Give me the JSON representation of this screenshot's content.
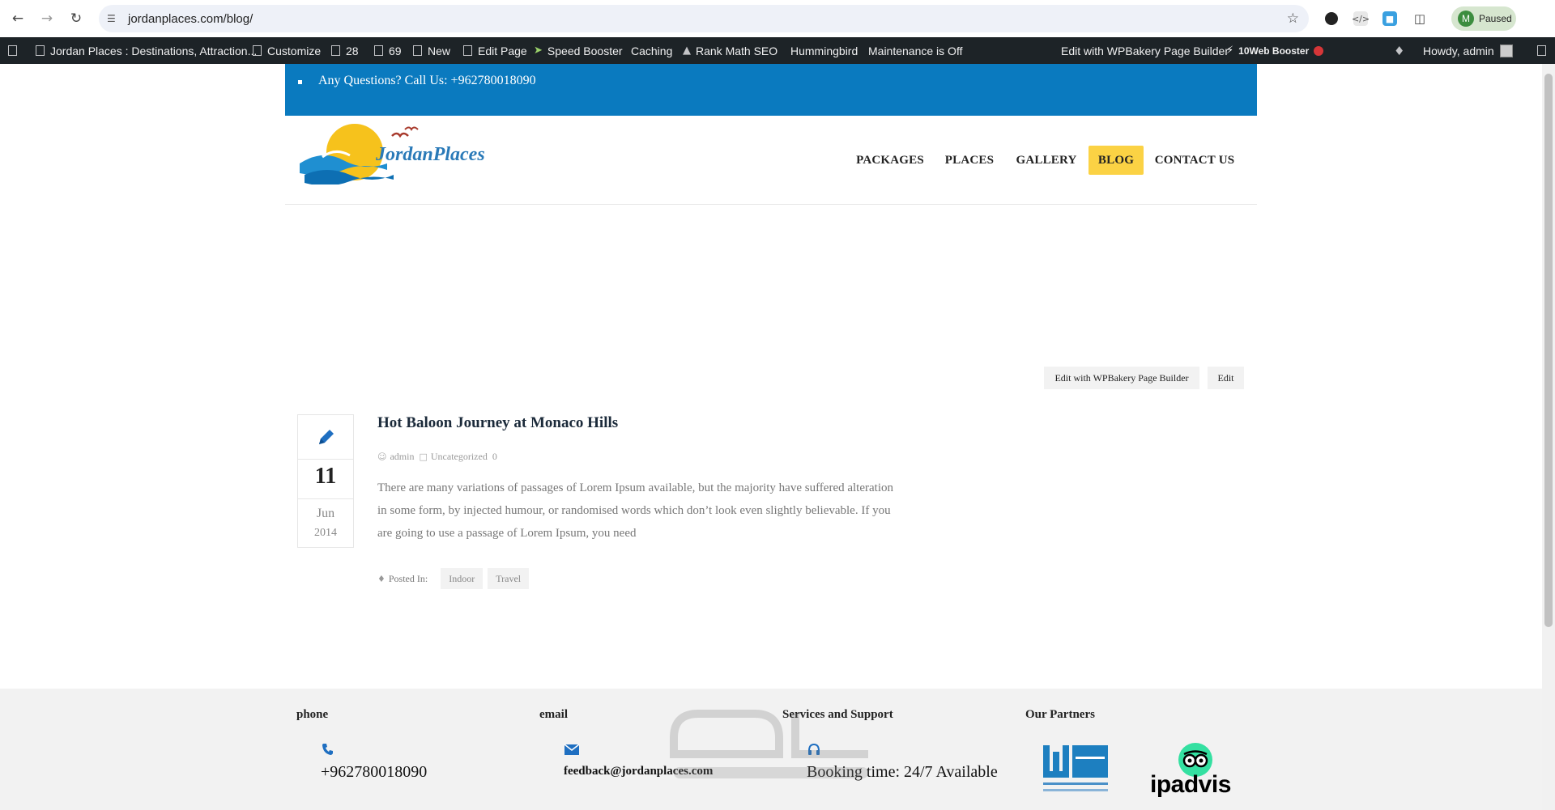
{
  "browser": {
    "url": "jordanplaces.com/blog/",
    "profile_initial": "M",
    "profile_label": "Paused"
  },
  "adminbar": {
    "site_name": "Jordan Places : Destinations, Attraction...",
    "customize": "Customize",
    "updates_count": "28",
    "comments_count": "69",
    "new": "New",
    "edit_page": "Edit Page",
    "speed_booster": "Speed Booster",
    "caching": "Caching",
    "rank_math": "Rank Math SEO",
    "hummingbird": "Hummingbird",
    "maintenance": "Maintenance is Off",
    "wpbakery": "Edit with WPBakery Page Builder",
    "booster": "10Web Booster",
    "howdy": "Howdy, admin"
  },
  "topbar": {
    "text": "Any Questions? Call Us: +962780018090"
  },
  "logo": {
    "text": "JordanPlaces"
  },
  "nav": {
    "items": [
      "PACKAGES",
      "PLACES",
      "GALLERY",
      "BLOG",
      "CONTACT US"
    ],
    "active": "BLOG"
  },
  "edit_buttons": {
    "wpbakery": "Edit with WPBakery Page Builder",
    "edit": "Edit"
  },
  "post": {
    "day": "11",
    "month": "Jun",
    "year": "2014",
    "title": "Hot Baloon Journey at Monaco Hills",
    "author": "admin",
    "category": "Uncategorized",
    "comments": "0",
    "excerpt_lines": [
      "There are many variations of passages of Lorem Ipsum available, but the majority have suffered alteration",
      "in some form, by injected humour, or randomised words which don’t look even slightly believable. If you",
      "are going to use a passage of Lorem Ipsum, you need"
    ],
    "posted_in_label": "Posted In:",
    "tags": [
      "Indoor",
      "Travel"
    ]
  },
  "footer": {
    "phone_heading": "phone",
    "phone_value": "+962780018090",
    "email_heading": "email",
    "email_value": "feedback@jordanplaces.com",
    "services_heading": "Services and Support",
    "services_value": "Booking time: 24/7 Available",
    "partners_heading": "Our Partners",
    "tripadvisor_text": "ipadvis"
  },
  "colors": {
    "topbar": "#0a7abf",
    "nav_active": "#fbd244",
    "adminbar": "#1d2327",
    "footer": "#f2f2f2",
    "icon_blue": "#1f6fc1"
  }
}
